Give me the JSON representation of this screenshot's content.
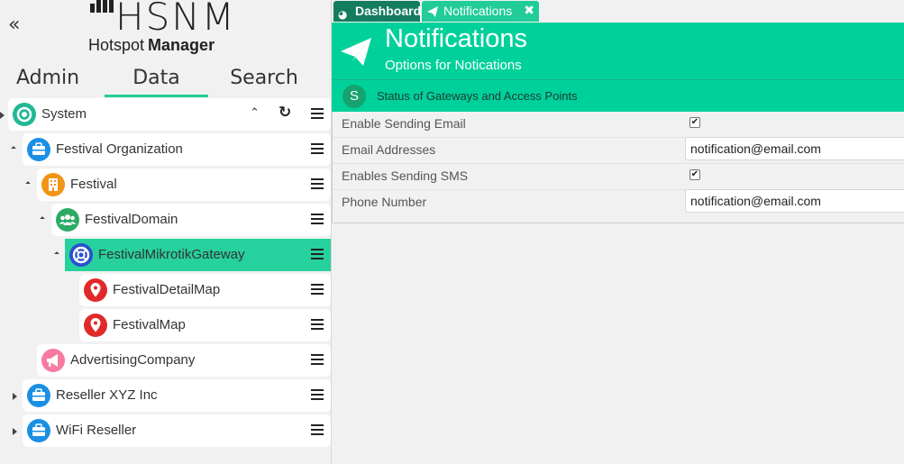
{
  "sidebar": {
    "collapse_icon": "double-chevron-left-icon",
    "logo": {
      "main": "HSNM",
      "tagline_light": "Hotspot",
      "tagline_bold": "Manager"
    },
    "tabs": [
      {
        "label": "Admin"
      },
      {
        "label": "Data",
        "active": true
      },
      {
        "label": "Search"
      }
    ],
    "tree": [
      {
        "label": "System",
        "icon": "system-icon",
        "color": "#22b893"
      },
      {
        "label": "Festival Organization",
        "icon": "briefcase-icon",
        "color": "#1a8fe3"
      },
      {
        "label": "Festival",
        "icon": "building-icon",
        "color": "#f29418"
      },
      {
        "label": "FestivalDomain",
        "icon": "group-icon",
        "color": "#2daa66"
      },
      {
        "label": "FestivalMikrotikGateway",
        "icon": "lifebuoy-icon",
        "color": "#2a4fd0",
        "selected": true
      },
      {
        "label": "FestivalDetailMap",
        "icon": "map-pin-icon",
        "color": "#e02a2a"
      },
      {
        "label": "FestivalMap",
        "icon": "map-pin-icon",
        "color": "#e02a2a"
      },
      {
        "label": "AdvertisingCompany",
        "icon": "megaphone-icon",
        "color": "#f77ba0"
      },
      {
        "label": "Reseller XYZ Inc",
        "icon": "briefcase-icon",
        "color": "#1a8fe3"
      },
      {
        "label": "WiFi Reseller",
        "icon": "briefcase-icon",
        "color": "#1a8fe3"
      }
    ]
  },
  "panel_tabs": [
    {
      "label": "Dashboard",
      "icon": "pie-chart-icon"
    },
    {
      "label": "Notifications",
      "icon": "paper-plane-icon",
      "close_icon": "close-icon"
    }
  ],
  "header": {
    "title": "Notifications",
    "subtitle": "Options for Notications"
  },
  "section": {
    "badge": "S",
    "title": "Status of Gateways and Access Points"
  },
  "form": {
    "enable_email_label": "Enable Sending Email",
    "enable_email_checked": true,
    "email_label": "Email Addresses",
    "email_value": "notification@email.com",
    "enable_sms_label": "Enables Sending SMS",
    "enable_sms_checked": true,
    "phone_label": "Phone Number",
    "phone_value": "notification@email.com"
  },
  "colors": {
    "accent": "#00d19a",
    "tab_dark": "#157d5f",
    "selected_node": "#26d19d"
  }
}
